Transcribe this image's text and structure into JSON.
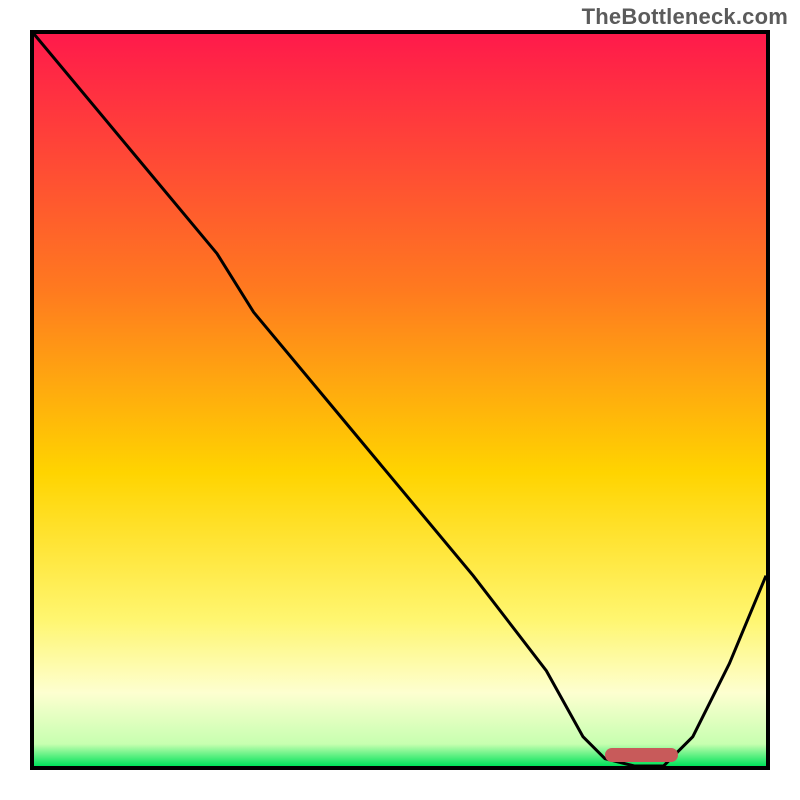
{
  "watermark": "TheBottleneck.com",
  "colors": {
    "top": "#ff1a4b",
    "mid_upper": "#ff7a1f",
    "mid": "#ffd400",
    "mid_lower": "#fff670",
    "pale": "#fdffd0",
    "green": "#00e35a",
    "border": "#000000",
    "curve": "#000000",
    "marker": "#c85a5a"
  },
  "chart_data": {
    "type": "line",
    "title": "",
    "xlabel": "",
    "ylabel": "",
    "xlim": [
      0,
      100
    ],
    "ylim": [
      0,
      100
    ],
    "note": "Axis is unlabeled; x is the horizontal extent of the plot, y is the vertical. Values estimated from pixel positions.",
    "series": [
      {
        "name": "bottleneck-curve",
        "x": [
          0,
          10,
          20,
          25,
          30,
          40,
          50,
          60,
          70,
          75,
          78,
          82,
          86,
          90,
          95,
          100
        ],
        "y": [
          100,
          88,
          76,
          70,
          62,
          50,
          38,
          26,
          13,
          4,
          1,
          0,
          0,
          4,
          14,
          26
        ]
      }
    ],
    "gradient_stops": [
      {
        "offset": 0.0,
        "color": "#ff1a4b"
      },
      {
        "offset": 0.35,
        "color": "#ff7a1f"
      },
      {
        "offset": 0.6,
        "color": "#ffd400"
      },
      {
        "offset": 0.8,
        "color": "#fff670"
      },
      {
        "offset": 0.9,
        "color": "#fdffd0"
      },
      {
        "offset": 0.97,
        "color": "#c7ffb0"
      },
      {
        "offset": 1.0,
        "color": "#00e35a"
      }
    ],
    "marker": {
      "x_start": 78,
      "x_end": 88,
      "y": 0,
      "color": "#c85a5a"
    }
  }
}
